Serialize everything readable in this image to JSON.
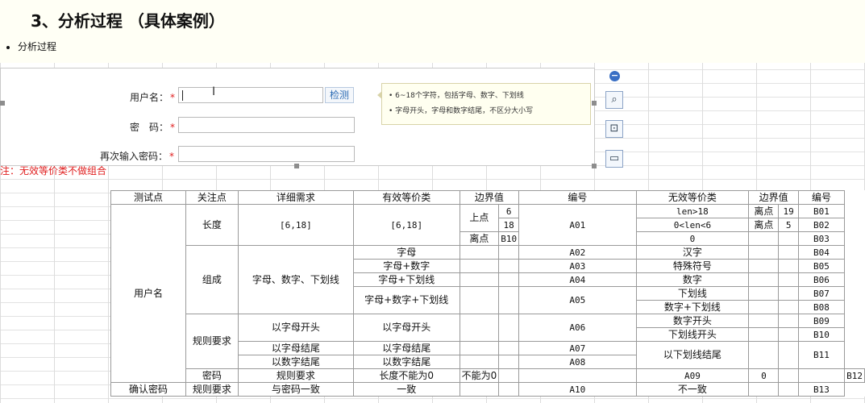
{
  "doc": {
    "heading": "3、分析过程 （具体案例）",
    "bullet": "分析过程"
  },
  "form": {
    "username_label": "用户名：",
    "password_label": "密　码：",
    "confirm_label": "再次输入密码：",
    "required_mark": "*",
    "check_button": "检测",
    "tips": [
      "6~18个字符，包括字母、数字、下划线",
      "字母开头，字母和数字结尾，不区分大小写"
    ],
    "note": "注：无效等价类不做组合"
  },
  "toolbar": {
    "icons": [
      "minus-icon",
      "zoom-icon",
      "crop-icon",
      "screen-icon"
    ]
  },
  "table": {
    "headers": {
      "test_point": "测试点",
      "focus": "关注点",
      "detail": "详细需求",
      "valid": "有效等价类",
      "boundary": "边界值",
      "id": "编号",
      "invalid": "无效等价类",
      "boundary2": "边界值",
      "id2": "编号"
    },
    "username": "用户名",
    "length": "长度",
    "length_range": "[6,18]",
    "valid_range": "[6,18]",
    "upper_point": "上点",
    "b6": "6",
    "b18": "18",
    "off_point": "离点",
    "b10": "B10",
    "a01": "A01",
    "inv1": "len>18",
    "inv2": "0<len<6",
    "inv3": "0",
    "off1": "离点",
    "off1v": "19",
    "off2": "离点",
    "off2v": "5",
    "b01": "B01",
    "b02": "B02",
    "b03": "B03",
    "compose": "组成",
    "compose_detail": "字母、数字、下划线",
    "v_letter": "字母",
    "v_letter_digit": "字母+数字",
    "v_letter_us": "字母+下划线",
    "v_all": "字母+数字+下划线",
    "a02": "A02",
    "a03": "A03",
    "a04": "A04",
    "a05": "A05",
    "i_hanzi": "汉字",
    "i_special": "特殊符号",
    "i_digit": "数字",
    "i_us": "下划线",
    "i_digit_us": "数字+下划线",
    "b04": "B04",
    "b05": "B05",
    "b06": "B06",
    "b07": "B07",
    "b08": "B08",
    "rules": "规则要求",
    "r_start": "以字母开头",
    "v_start": "以字母开头",
    "a06": "A06",
    "i_digit_start": "数字开头",
    "i_us_start": "下划线开头",
    "b09": "B09",
    "r_end_letter": "以字母结尾",
    "v_end_letter": "以字母结尾",
    "a07": "A07",
    "r_end_digit": "以数字结尾",
    "v_end_digit": "以数字结尾",
    "a08": "A08",
    "i_us_end": "以下划线结尾",
    "b11": "B11",
    "pwd": "密码",
    "pwd_rules": "规则要求",
    "pwd_detail": "长度不能为0",
    "pwd_valid": "不能为0",
    "a09": "A09",
    "pwd_invalid": "0",
    "b12": "B12",
    "confirm": "确认密码",
    "confirm_rules": "规则要求",
    "confirm_detail": "与密码一致",
    "confirm_valid": "一致",
    "a10": "A10",
    "confirm_invalid": "不一致",
    "b13": "B13"
  }
}
